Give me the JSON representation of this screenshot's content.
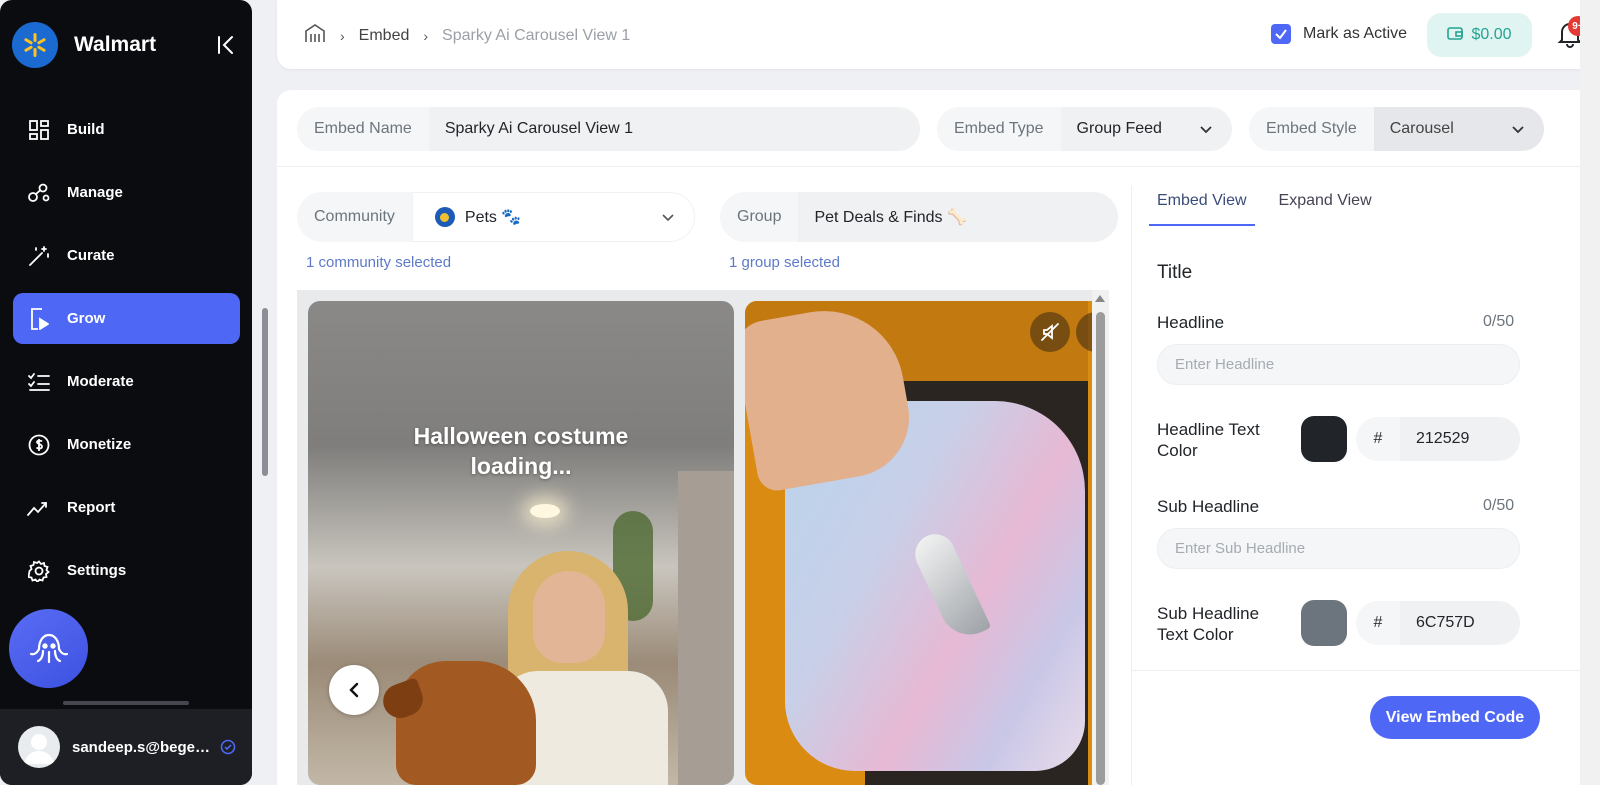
{
  "sidebar": {
    "brand": "Walmart",
    "items": [
      {
        "label": "Build",
        "icon": "grid-icon"
      },
      {
        "label": "Manage",
        "icon": "nodes-icon"
      },
      {
        "label": "Curate",
        "icon": "magic-wand-icon"
      },
      {
        "label": "Grow",
        "icon": "play-doc-icon",
        "active": true
      },
      {
        "label": "Moderate",
        "icon": "checklist-icon"
      },
      {
        "label": "Monetize",
        "icon": "dollar-circle-icon"
      },
      {
        "label": "Report",
        "icon": "trend-icon"
      },
      {
        "label": "Settings",
        "icon": "gear-icon"
      }
    ],
    "user_email": "sandeep.s@begen..."
  },
  "topbar": {
    "breadcrumb": [
      "Embed",
      "Sparky Ai Carousel View 1"
    ],
    "mark_active_label": "Mark as Active",
    "mark_active_checked": true,
    "wallet_balance": "$0.00",
    "notification_badge": "9+"
  },
  "form": {
    "embed_name_label": "Embed Name",
    "embed_name_value": "Sparky Ai Carousel View 1",
    "embed_type_label": "Embed Type",
    "embed_type_value": "Group Feed",
    "embed_style_label": "Embed Style",
    "embed_style_value": "Carousel",
    "community_label": "Community",
    "community_value": "Pets 🐾",
    "community_note": "1 community selected",
    "group_label": "Group",
    "group_value": "Pet Deals & Finds 🦴",
    "group_note": "1 group selected"
  },
  "carousel": {
    "card1_text_line1": "Halloween costume",
    "card1_text_line2": "loading..."
  },
  "panel": {
    "tabs": [
      "Embed View",
      "Expand View"
    ],
    "section_title": "Title",
    "headline_label": "Headline",
    "headline_counter": "0/50",
    "headline_placeholder": "Enter Headline",
    "headline_color_label": "Headline Text Color",
    "headline_color_hash": "#",
    "headline_color_value": "212529",
    "sub_headline_label": "Sub Headline",
    "sub_headline_counter": "0/50",
    "sub_headline_placeholder": "Enter Sub Headline",
    "sub_headline_color_label": "Sub Headline Text Color",
    "sub_headline_color_hash": "#",
    "sub_headline_color_value": "6C757D",
    "view_embed_code": "View Embed Code"
  },
  "colors": {
    "accent": "#4e68f5",
    "headline_swatch": "#212529",
    "sub_headline_swatch": "#6c757d",
    "wallet_green": "#24a392"
  }
}
